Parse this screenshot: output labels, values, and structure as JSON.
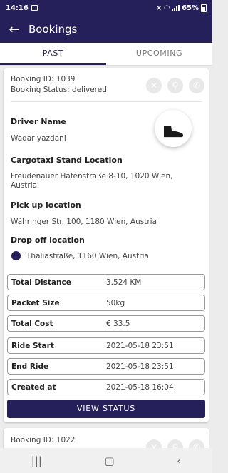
{
  "status_bar": {
    "time": "14:16",
    "battery": "65%"
  },
  "app_bar": {
    "title": "Bookings"
  },
  "tabs": [
    {
      "label": "PAST"
    },
    {
      "label": "UPCOMING"
    }
  ],
  "booking": {
    "id_text": "Booking ID: 1039",
    "status_text": "Booking Status: delivered",
    "driver_label": "Driver Name",
    "driver_name": "Waqar yazdani",
    "stand_label": "Cargotaxi Stand Location",
    "stand_value": "Freudenauer Hafenstraße 8-10, 1020 Wien, Austria",
    "pickup_label": "Pick up location",
    "pickup_value": "Währinger Str. 100, 1180 Wien, Austria",
    "dropoff_label": "Drop off location",
    "dropoff_value": "Thaliastraße, 1160 Wien, Austria",
    "details": [
      {
        "key": "Total Distance",
        "value": "3.524 KM"
      },
      {
        "key": "Packet Size",
        "value": "50kg"
      },
      {
        "key": "Total Cost",
        "value": "€ 33.5"
      },
      {
        "key": "Ride Start",
        "value": "2021-05-18 23:51"
      },
      {
        "key": "End Ride",
        "value": "2021-05-18 23:51"
      },
      {
        "key": "Created at",
        "value": "2021-05-18 16:04"
      }
    ],
    "view_status_label": "VIEW STATUS"
  },
  "next_booking": {
    "id_text": "Booking ID: 1022"
  },
  "colors": {
    "primary": "#26205a"
  }
}
